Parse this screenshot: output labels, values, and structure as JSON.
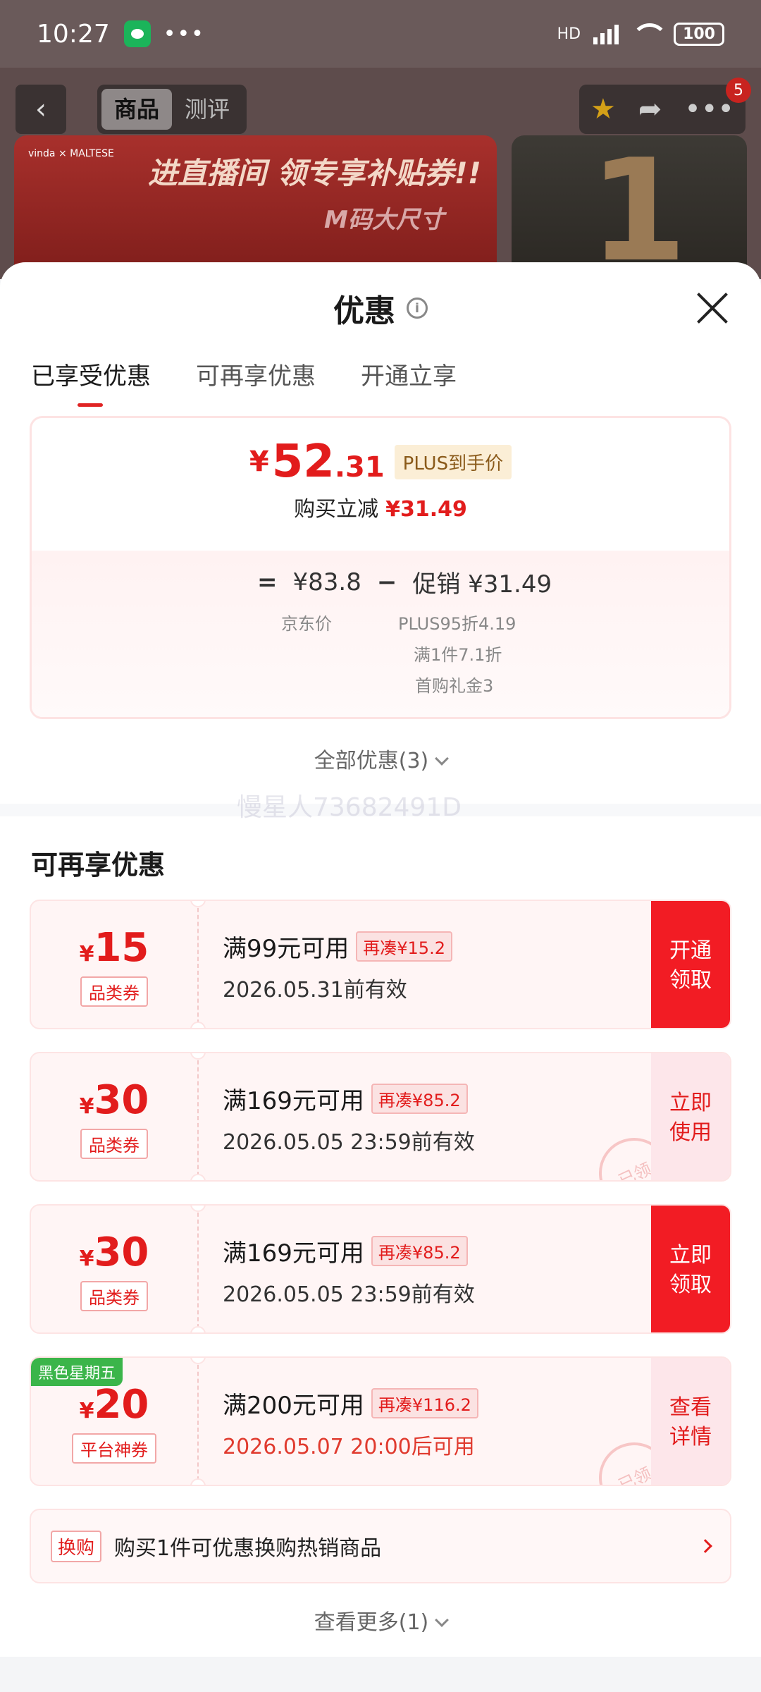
{
  "status_bar": {
    "time": "10:27",
    "dots": "•••",
    "network": "HD",
    "battery": "100"
  },
  "nav": {
    "segments": [
      "商品",
      "测评"
    ],
    "cart_badge": "5",
    "banner_title": "进直播间 领专享补贴券!!",
    "banner_subtitle": "M码大尺寸",
    "banner_brand": "vinda × MALTESE",
    "banner2_number": "1"
  },
  "sheet": {
    "title": "优惠",
    "tabs": [
      "已享受优惠",
      "可再享优惠",
      "开通立享"
    ],
    "price": {
      "symbol": "¥",
      "integer": "52",
      "decimal": ".31",
      "plus_tag": "PLUS到手价",
      "reduce_label": "购买立减",
      "reduce_value": "¥31.49"
    },
    "formula": {
      "equals": "=",
      "jd_price": "¥83.8",
      "minus": "−",
      "promo": "促销 ¥31.49",
      "jd_label": "京东价",
      "promo_details": [
        "PLUS95折4.19",
        "满1件7.1折",
        "首购礼金3"
      ]
    },
    "all_toggle": "全部优惠(3)",
    "watermark": "慢星人73682491D",
    "section_title": "可再享优惠",
    "coupons": [
      {
        "symbol": "¥",
        "amount": "15",
        "tag": "品类券",
        "condition": "满99元可用",
        "reach": "再凑¥15.2",
        "validity": "2026.05.31前有效",
        "button": "开通\n领取",
        "claimed": false
      },
      {
        "symbol": "¥",
        "amount": "30",
        "tag": "品类券",
        "condition": "满169元可用",
        "reach": "再凑¥85.2",
        "validity": "2026.05.05 23:59前有效",
        "button": "立即\n使用",
        "claimed": true,
        "stamp": "已领"
      },
      {
        "symbol": "¥",
        "amount": "30",
        "tag": "品类券",
        "condition": "满169元可用",
        "reach": "再凑¥85.2",
        "validity": "2026.05.05 23:59前有效",
        "button": "立即\n领取",
        "claimed": false
      },
      {
        "symbol": "¥",
        "amount": "20",
        "tag": "平台神券",
        "badge": "黑色星期五",
        "condition": "满200元可用",
        "reach": "再凑¥116.2",
        "validity": "2026.05.07 20:00后可用",
        "button": "查看\n详情",
        "claimed": true,
        "stamp": "已领"
      }
    ],
    "swap": {
      "tag": "换购",
      "text": "购买1件可优惠换购热销商品"
    },
    "more_toggle": "查看更多(1)"
  },
  "colors": {
    "accent_red": "#e21c1c",
    "button_red": "#f21c24",
    "plus_tag_bg": "#fbeed6",
    "friday_green": "#3bb54a"
  }
}
